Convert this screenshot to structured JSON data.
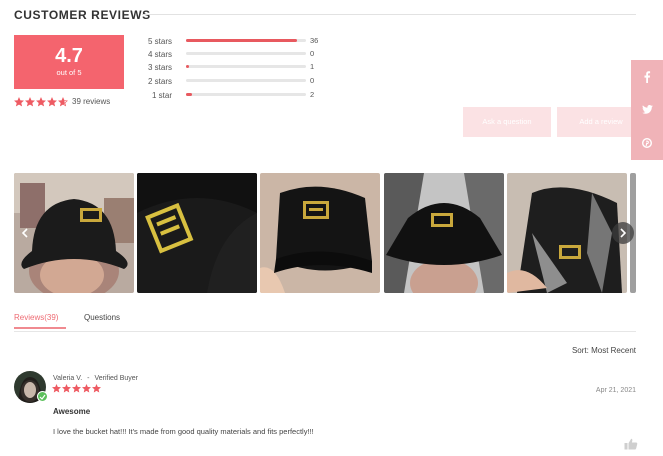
{
  "reviews_header": {
    "title": "CUSTOMER REVIEWS"
  },
  "summary": {
    "score": "4.7",
    "score_sub": "out of 5",
    "rating_stars": 4.7,
    "review_count_text": "39 reviews"
  },
  "breakdown": [
    {
      "label": "5 stars",
      "count": "36",
      "share": 0.923
    },
    {
      "label": "4 stars",
      "count": "0",
      "share": 0
    },
    {
      "label": "3 stars",
      "count": "1",
      "share": 0.026
    },
    {
      "label": "2 stars",
      "count": "0",
      "share": 0
    },
    {
      "label": "1 star",
      "count": "2",
      "share": 0.051
    }
  ],
  "actions": {
    "ask_question": "Ask a question",
    "add_review": "Add a review"
  },
  "social": [
    "facebook-icon",
    "twitter-icon",
    "pinterest-icon"
  ],
  "tabs": [
    {
      "label": "Reviews(39)",
      "active": true
    },
    {
      "label": "Questions",
      "active": false
    }
  ],
  "sort": {
    "label": "Sort:",
    "value": "Most Recent"
  },
  "review": {
    "name": "Valeria V.",
    "separator": "-",
    "badge": "Verified Buyer",
    "stars": 5,
    "date": "Apr 21, 2021",
    "title": "Awesome",
    "body": "I love the bucket hat!!! It's made from good quality materials and fits perfectly!!!"
  },
  "colors": {
    "accent": "#f4646e",
    "star": "#ee5b63",
    "bar": "#e8595f",
    "verified": "#5cc05c",
    "social_bg": "#f0b3b8",
    "pale_button": "#fbe2e4"
  }
}
